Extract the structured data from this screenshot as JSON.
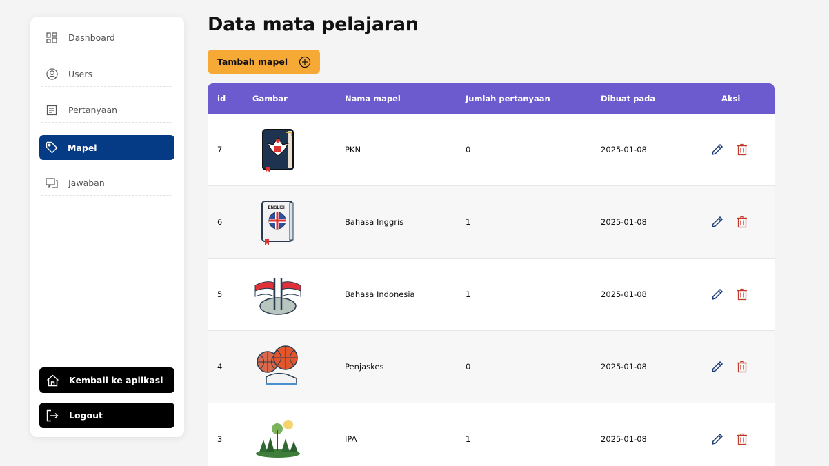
{
  "sidebar": {
    "items": [
      {
        "label": "Dashboard",
        "icon": "grid-icon",
        "active": false
      },
      {
        "label": "Users",
        "icon": "user-circle-icon",
        "active": false
      },
      {
        "label": "Pertanyaan",
        "icon": "document-icon",
        "active": false
      },
      {
        "label": "Mapel",
        "icon": "tag-icon",
        "active": true
      },
      {
        "label": "Jawaban",
        "icon": "chat-icon",
        "active": false
      }
    ],
    "back_label": "Kembali ke aplikasi",
    "logout_label": "Logout"
  },
  "main": {
    "title": "Data mata pelajaran",
    "add_button_label": "Tambah mapel",
    "columns": [
      "id",
      "Gambar",
      "Nama mapel",
      "Jumlah pertanyaan",
      "Dibuat pada",
      "Aksi"
    ],
    "rows": [
      {
        "id": "7",
        "image": "pkn-book-icon",
        "name": "PKN",
        "count": "0",
        "created": "2025-01-08"
      },
      {
        "id": "6",
        "image": "english-book-icon",
        "name": "Bahasa Inggris",
        "count": "1",
        "created": "2025-01-08"
      },
      {
        "id": "5",
        "image": "indonesia-flags-icon",
        "name": "Bahasa Indonesia",
        "count": "1",
        "created": "2025-01-08"
      },
      {
        "id": "4",
        "image": "sports-balls-icon",
        "name": "Penjaskes",
        "count": "0",
        "created": "2025-01-08"
      },
      {
        "id": "3",
        "image": "forest-icon",
        "name": "IPA",
        "count": "1",
        "created": "2025-01-08"
      }
    ]
  },
  "colors": {
    "accent_orange": "#f7a936",
    "header_purple": "#6c5bcf",
    "active_nav": "#053a85",
    "delete_red": "#c0392b",
    "edit_blue": "#1a3c7a"
  }
}
